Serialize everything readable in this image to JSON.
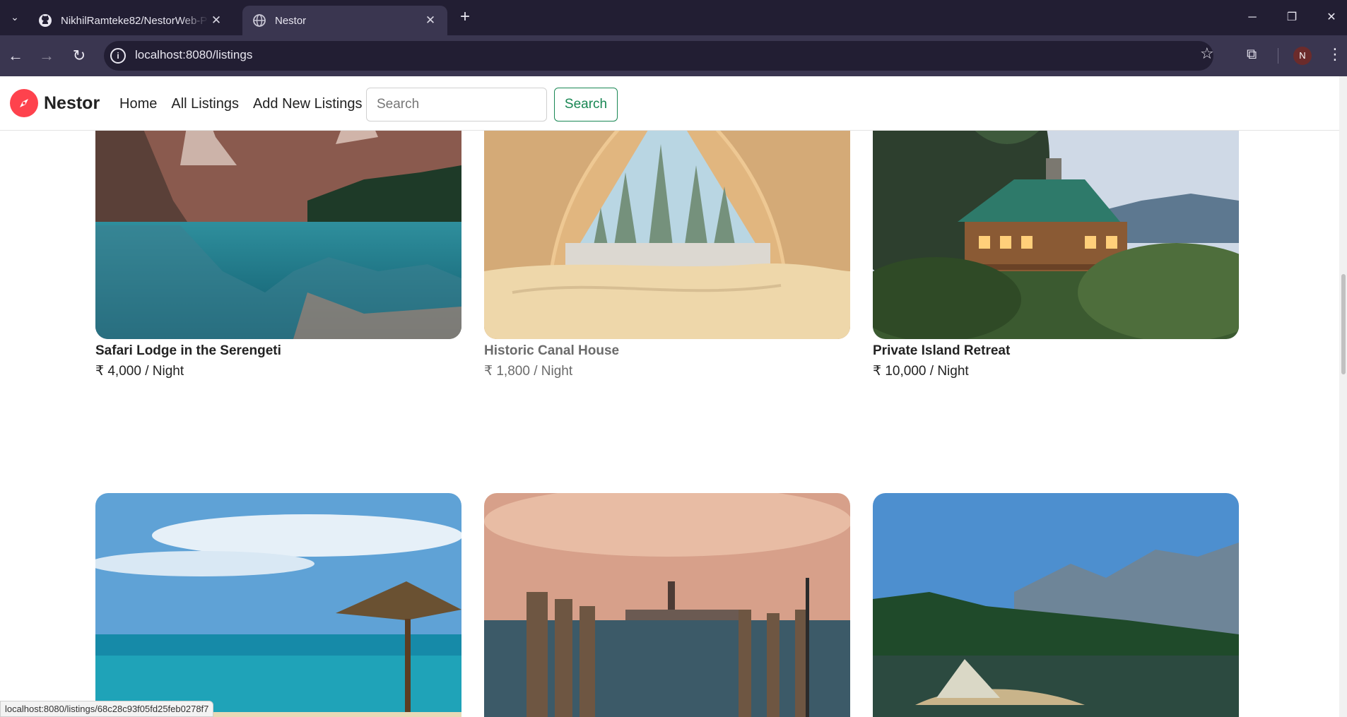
{
  "browser": {
    "tabs": [
      {
        "title": "NikhilRamteke82/NestorWeb-P",
        "icon": "github-icon"
      },
      {
        "title": "Nestor",
        "icon": "globe-icon"
      }
    ],
    "url": "localhost:8080/listings",
    "profile_initial": "N"
  },
  "navbar": {
    "brand": "Nestor",
    "links": [
      "Home",
      "All Listings",
      "Add New Listings"
    ],
    "search_placeholder": "Search",
    "search_button": "Search",
    "brand_color": "#fe424d",
    "accent_color": "#198754"
  },
  "listings": [
    {
      "title": "Safari Lodge in the Serengeti",
      "price": "₹ 4,000 / Night"
    },
    {
      "title": "Historic Canal House",
      "price": "₹ 1,800 / Night"
    },
    {
      "title": "Private Island Retreat",
      "price": "₹ 10,000 / Night"
    }
  ],
  "status_url": "localhost:8080/listings/68c28c93f05fd25feb0278f7"
}
